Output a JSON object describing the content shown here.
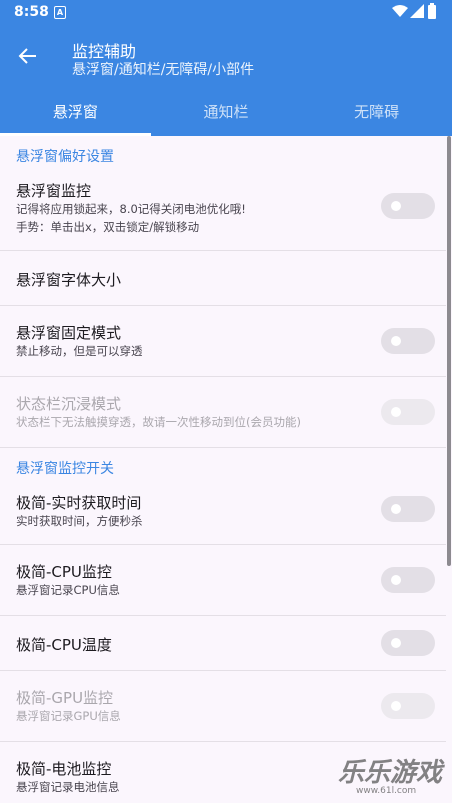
{
  "status": {
    "time": "8:58",
    "notif_icon": "A"
  },
  "appbar": {
    "title": "监控辅助",
    "subtitle": "悬浮窗/通知栏/无障碍/小部件"
  },
  "tabs": [
    {
      "label": "悬浮窗",
      "active": true
    },
    {
      "label": "通知栏",
      "active": false
    },
    {
      "label": "无障碍",
      "active": false
    }
  ],
  "sections": [
    {
      "title": "悬浮窗偏好设置"
    },
    {
      "title": "悬浮窗监控开关"
    }
  ],
  "items": [
    {
      "title": "悬浮窗监控",
      "summary": [
        "记得将应用锁起来，8.0记得关闭电池优化哦!",
        "手势：单击出x，双击锁定/解锁移动"
      ],
      "toggle": false,
      "disabled": false
    },
    {
      "title": "悬浮窗字体大小",
      "summary": [],
      "disabled": false
    },
    {
      "title": "悬浮窗固定模式",
      "summary": [
        "禁止移动，但是可以穿透"
      ],
      "toggle": false,
      "disabled": false
    },
    {
      "title": "状态栏沉浸模式",
      "summary": [
        "状态栏下无法触摸穿透，故请一次性移动到位(会员功能)"
      ],
      "toggle": false,
      "disabled": true
    },
    {
      "title": "极简-实时获取时间",
      "summary": [
        "实时获取时间，方便秒杀"
      ],
      "toggle": false,
      "disabled": false
    },
    {
      "title": "极简-CPU监控",
      "summary": [
        "悬浮窗记录CPU信息"
      ],
      "toggle": false,
      "disabled": false
    },
    {
      "title": "极简-CPU温度",
      "summary": [],
      "toggle": false,
      "disabled": false
    },
    {
      "title": "极简-GPU监控",
      "summary": [
        "悬浮窗记录GPU信息"
      ],
      "toggle": false,
      "disabled": true
    },
    {
      "title": "极简-电池监控",
      "summary": [
        "悬浮窗记录电池信息"
      ],
      "toggle": false,
      "disabled": false
    }
  ],
  "watermark": {
    "text": "乐乐游戏",
    "url": "www.61l.com"
  },
  "colors": {
    "primary": "#3b86e2",
    "background": "#fbf6fd"
  }
}
